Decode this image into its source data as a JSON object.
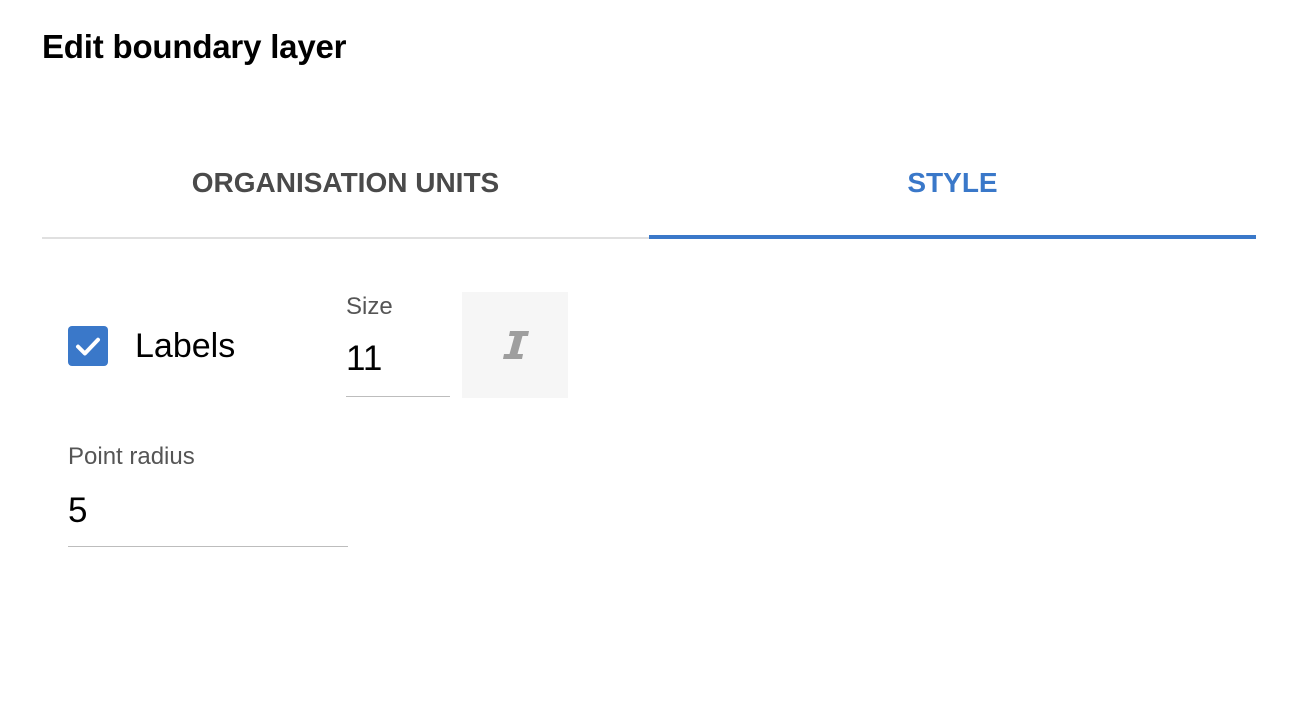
{
  "dialog": {
    "title": "Edit boundary layer"
  },
  "tabs": [
    {
      "label": "ORGANISATION UNITS",
      "active": false
    },
    {
      "label": "STYLE",
      "active": true
    }
  ],
  "style": {
    "labels_checkbox": {
      "label": "Labels",
      "checked": true
    },
    "size": {
      "label": "Size",
      "value": "11"
    },
    "italic_button": {
      "icon": "italic-icon"
    },
    "point_radius": {
      "label": "Point radius",
      "value": "5"
    }
  },
  "colors": {
    "accent": "#3a78c9",
    "tab_inactive": "#4a4a4a",
    "divider": "#e0e0e0",
    "icon_grey": "#9e9e9e",
    "button_bg": "#f6f6f6"
  }
}
